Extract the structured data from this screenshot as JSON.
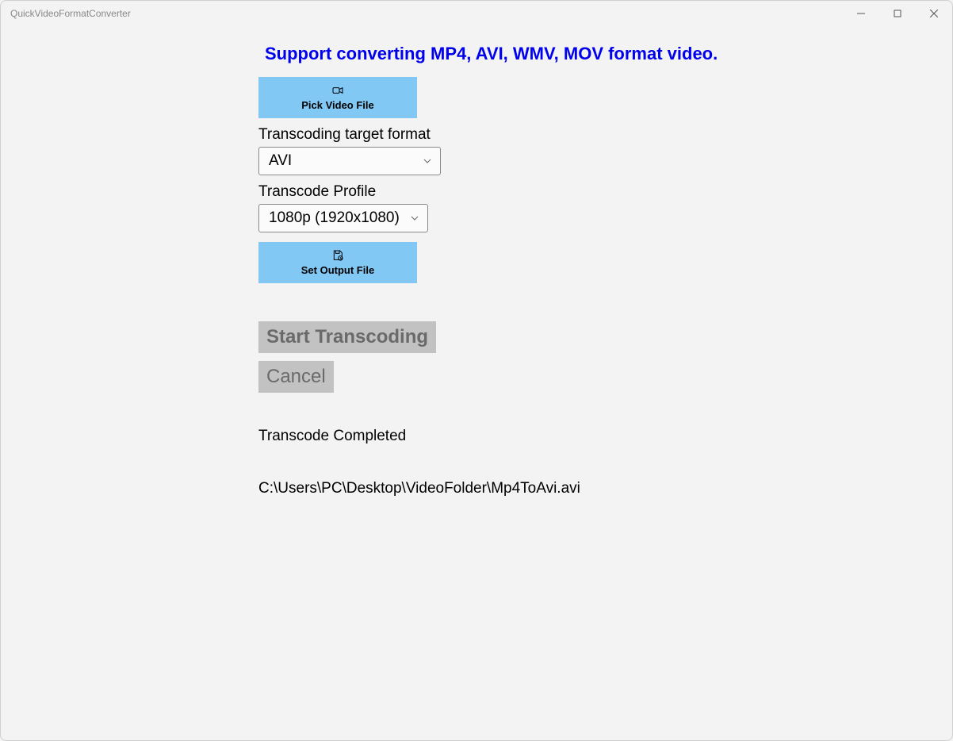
{
  "window": {
    "title": "QuickVideoFormatConverter"
  },
  "headline": "Support converting MP4, AVI, WMV, MOV format video.",
  "buttons": {
    "pick_video": "Pick Video File",
    "set_output": "Set Output File",
    "start": "Start Transcoding",
    "cancel": "Cancel"
  },
  "labels": {
    "target_format": "Transcoding target format",
    "profile": "Transcode Profile"
  },
  "selects": {
    "format_value": "AVI",
    "profile_value": "1080p (1920x1080)"
  },
  "status": "Transcode Completed",
  "output_path": "C:\\Users\\PC\\Desktop\\VideoFolder\\Mp4ToAvi.avi"
}
